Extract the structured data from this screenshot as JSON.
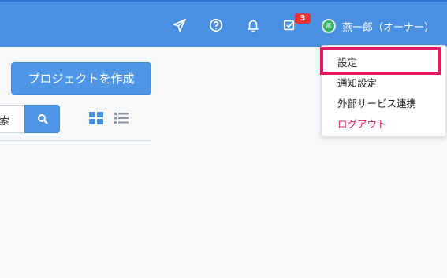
{
  "header": {
    "notification_badge": "3",
    "user_name": "燕一郎（オーナー）",
    "avatar_text": "燕",
    "icons": [
      "send-icon",
      "help-icon",
      "bell-icon",
      "task-check-icon"
    ],
    "colors": {
      "bar": "#4a90e2",
      "badge": "#e53238",
      "avatar": "#38b26b"
    }
  },
  "main": {
    "create_project_label": "プロジェクトを作成",
    "search_value": "索",
    "view_modes": [
      "grid-view-icon",
      "list-view-icon"
    ]
  },
  "dropdown": {
    "items": [
      {
        "label": "設定"
      },
      {
        "label": "通知設定"
      },
      {
        "label": "外部サービス連携"
      },
      {
        "label": "ログアウト"
      }
    ],
    "logout_color": "#e0245e",
    "highlight_color": "#e5195f"
  }
}
